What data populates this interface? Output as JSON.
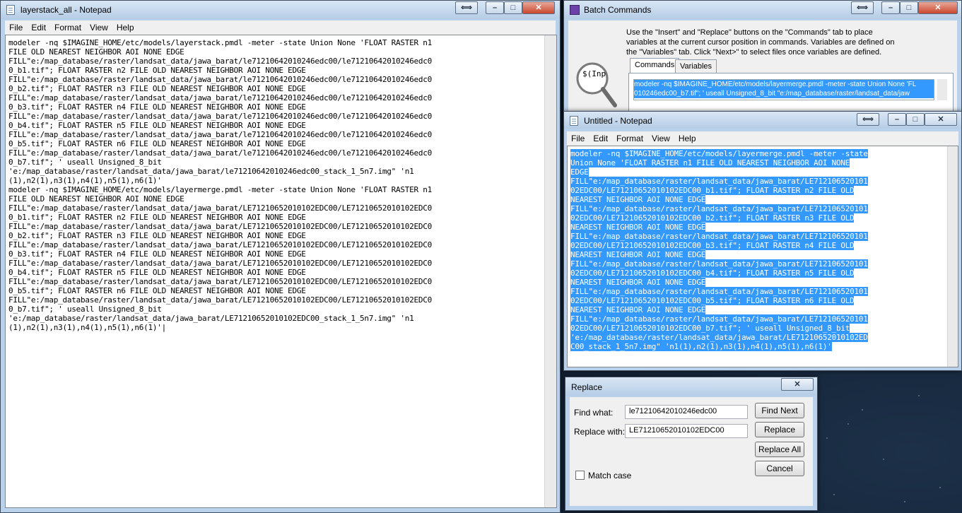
{
  "colors": {
    "selection": "#3399ff",
    "title_bar": "#b9d1ea",
    "desktop": "#0b1320"
  },
  "menu": [
    "File",
    "Edit",
    "Format",
    "View",
    "Help"
  ],
  "notepad_main": {
    "title": "layerstack_all - Notepad",
    "lines": [
      "modeler -nq $IMAGINE_HOME/etc/models/layerstack.pmdl -meter -state Union None 'FLOAT RASTER n1",
      "FILE OLD NEAREST NEIGHBOR AOI NONE EDGE",
      "FILL\"e:/map_database/raster/landsat_data/jawa_barat/le71210642010246edc00/le71210642010246edc0",
      "0_b1.tif\"; FLOAT RASTER n2 FILE OLD NEAREST NEIGHBOR AOI NONE EDGE",
      "FILL\"e:/map_database/raster/landsat_data/jawa_barat/le71210642010246edc00/le71210642010246edc0",
      "0_b2.tif\"; FLOAT RASTER n3 FILE OLD NEAREST NEIGHBOR AOI NONE EDGE",
      "FILL\"e:/map_database/raster/landsat_data/jawa_barat/le71210642010246edc00/le71210642010246edc0",
      "0_b3.tif\"; FLOAT RASTER n4 FILE OLD NEAREST NEIGHBOR AOI NONE EDGE",
      "FILL\"e:/map_database/raster/landsat_data/jawa_barat/le71210642010246edc00/le71210642010246edc0",
      "0_b4.tif\"; FLOAT RASTER n5 FILE OLD NEAREST NEIGHBOR AOI NONE EDGE",
      "FILL\"e:/map_database/raster/landsat_data/jawa_barat/le71210642010246edc00/le71210642010246edc0",
      "0_b5.tif\"; FLOAT RASTER n6 FILE OLD NEAREST NEIGHBOR AOI NONE EDGE",
      "FILL\"e:/map_database/raster/landsat_data/jawa_barat/le71210642010246edc00/le71210642010246edc0",
      "0_b7.tif\"; ' useall Unsigned_8_bit",
      "'e:/map_database/raster/landsat_data/jawa_barat/le71210642010246edc00_stack_1_5n7.img\" 'n1",
      "(1),n2(1),n3(1),n4(1),n5(1),n6(1)'",
      "modeler -nq $IMAGINE_HOME/etc/models/layermerge.pmdl -meter -state Union None 'FLOAT RASTER n1",
      "FILE OLD NEAREST NEIGHBOR AOI NONE EDGE",
      "FILL\"e:/map_database/raster/landsat_data/jawa_barat/LE71210652010102EDC00/LE71210652010102EDC0",
      "0_b1.tif\"; FLOAT RASTER n2 FILE OLD NEAREST NEIGHBOR AOI NONE EDGE",
      "FILL\"e:/map_database/raster/landsat_data/jawa_barat/LE71210652010102EDC00/LE71210652010102EDC0",
      "0_b2.tif\"; FLOAT RASTER n3 FILE OLD NEAREST NEIGHBOR AOI NONE EDGE",
      "FILL\"e:/map_database/raster/landsat_data/jawa_barat/LE71210652010102EDC00/LE71210652010102EDC0",
      "0_b3.tif\"; FLOAT RASTER n4 FILE OLD NEAREST NEIGHBOR AOI NONE EDGE",
      "FILL\"e:/map_database/raster/landsat_data/jawa_barat/LE71210652010102EDC00/LE71210652010102EDC0",
      "0_b4.tif\"; FLOAT RASTER n5 FILE OLD NEAREST NEIGHBOR AOI NONE EDGE",
      "FILL\"e:/map_database/raster/landsat_data/jawa_barat/LE71210652010102EDC00/LE71210652010102EDC0",
      "0_b5.tif\"; FLOAT RASTER n6 FILE OLD NEAREST NEIGHBOR AOI NONE EDGE",
      "FILL\"e:/map_database/raster/landsat_data/jawa_barat/LE71210652010102EDC00/LE71210652010102EDC0",
      "0_b7.tif\"; ' useall Unsigned_8_bit",
      "'e:/map_database/raster/landsat_data/jawa_barat/LE71210652010102EDC00_stack_1_5n7.img\" 'n1",
      "(1),n2(1),n3(1),n4(1),n5(1),n6(1)'|"
    ]
  },
  "batch": {
    "title": "Batch Commands",
    "instructions": [
      "Use the \"Insert\" and \"Replace\" buttons on the \"Commands\" tab to place",
      "variables at the current cursor position in commands. Variables are defined on",
      "the \"Variables\" tab. Click \"Next>\" to select files once variables are defined."
    ],
    "magnifier_text": "$(Inp",
    "tabs": [
      "Commands",
      "Variables"
    ],
    "command_lines": [
      "modeler -nq $IMAGINE_HOME/etc/models/layermerge.pmdl -meter -state Union None 'FL",
      "010246edc00_b7.tif\"; ' useall Unsigned_8_bit \"e:/map_database/raster/landsat_data/jaw"
    ]
  },
  "notepad_untitled": {
    "title": "Untitled - Notepad",
    "lines": [
      "modeler -nq $IMAGINE_HOME/etc/models/layermerge.pmdl -meter -state",
      "Union None 'FLOAT RASTER n1 FILE OLD NEAREST NEIGHBOR AOI NONE",
      "EDGE",
      "FILL\"e:/map_database/raster/landsat_data/jawa_barat/LE712106520101",
      "02EDC00/LE71210652010102EDC00_b1.tif\"; FLOAT RASTER n2 FILE OLD",
      "NEAREST NEIGHBOR AOI NONE EDGE",
      "FILL\"e:/map_database/raster/landsat_data/jawa_barat/LE712106520101",
      "02EDC00/LE71210652010102EDC00_b2.tif\"; FLOAT RASTER n3 FILE OLD",
      "NEAREST NEIGHBOR AOI NONE EDGE",
      "FILL\"e:/map_database/raster/landsat_data/jawa_barat/LE712106520101",
      "02EDC00/LE71210652010102EDC00_b3.tif\"; FLOAT RASTER n4 FILE OLD",
      "NEAREST NEIGHBOR AOI NONE EDGE",
      "FILL\"e:/map_database/raster/landsat_data/jawa_barat/LE712106520101",
      "02EDC00/LE71210652010102EDC00_b4.tif\"; FLOAT RASTER n5 FILE OLD",
      "NEAREST NEIGHBOR AOI NONE EDGE",
      "FILL\"e:/map_database/raster/landsat_data/jawa_barat/LE712106520101",
      "02EDC00/LE71210652010102EDC00_b5.tif\"; FLOAT RASTER n6 FILE OLD",
      "NEAREST NEIGHBOR AOI NONE EDGE",
      "FILL\"e:/map_database/raster/landsat_data/jawa_barat/LE712106520101",
      "02EDC00/LE71210652010102EDC00_b7.tif\"; ' useall Unsigned_8_bit",
      "'e:/map_database/raster/landsat_data/jawa_barat/LE71210652010102ED",
      "C00_stack_1_5n7.img\" 'n1(1),n2(1),n3(1),n4(1),n5(1),n6(1)'"
    ]
  },
  "replace": {
    "title": "Replace",
    "find_label": "Find what:",
    "find_value": "le71210642010246edc00",
    "replace_label": "Replace with:",
    "replace_value": "LE71210652010102EDC00",
    "match_case_label": "Match case",
    "buttons": {
      "find_next": "Find Next",
      "replace": "Replace",
      "replace_all": "Replace All",
      "cancel": "Cancel"
    }
  }
}
